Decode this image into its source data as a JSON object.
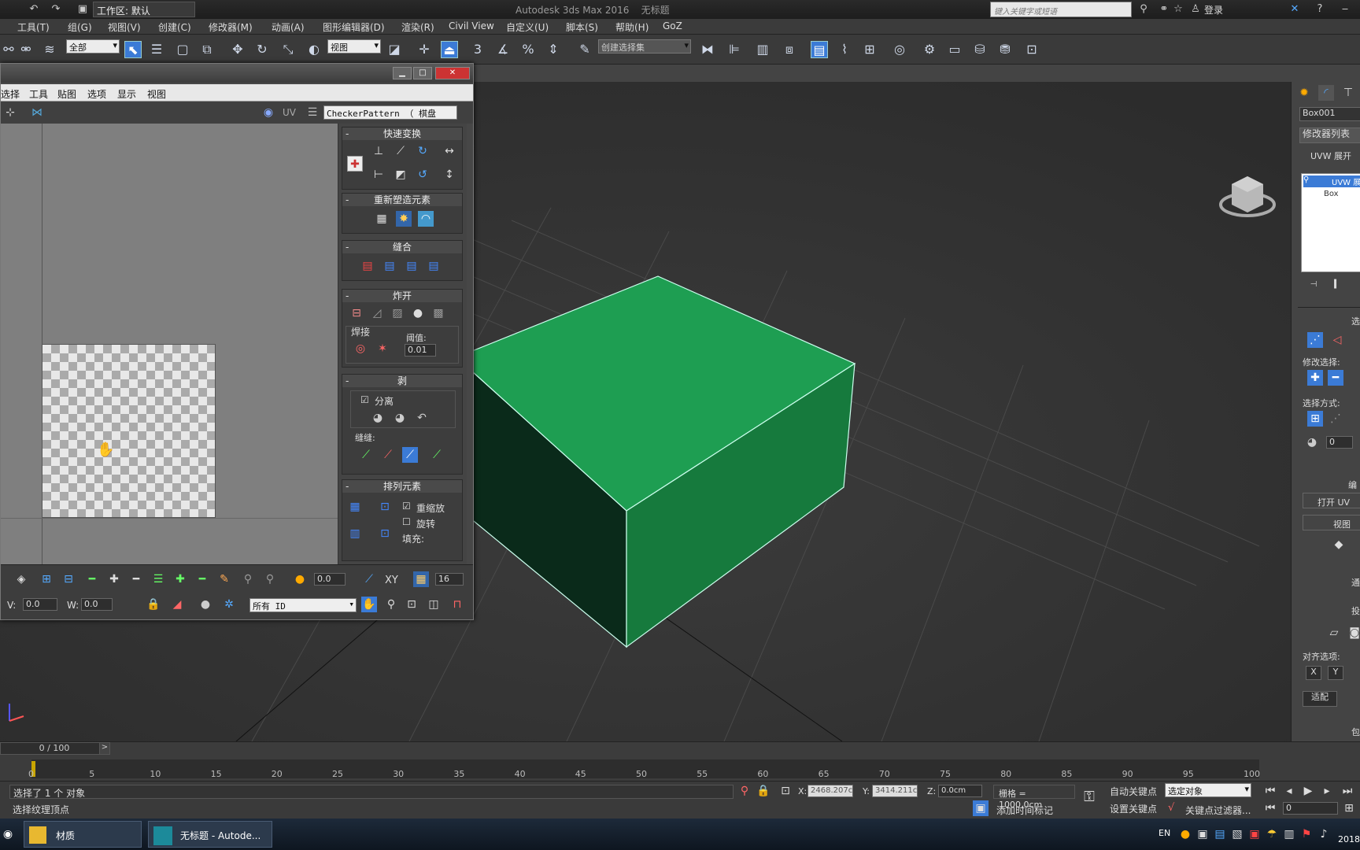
{
  "titlebar": {
    "workspace": "工作区: 默认",
    "app_title": "Autodesk 3ds Max 2016",
    "doc_title": "无标题",
    "search_placeholder": "键入关键字或短语",
    "login": "登录"
  },
  "menu": [
    "工具(T)",
    "组(G)",
    "视图(V)",
    "创建(C)",
    "修改器(M)",
    "动画(A)",
    "图形编辑器(D)",
    "渲染(R)",
    "Civil View",
    "自定义(U)",
    "脚本(S)",
    "帮助(H)",
    "GoZ"
  ],
  "toolbar": {
    "filter": "全部",
    "ref_coord": "视图",
    "named_selection": "创建选择集",
    "num3": "3"
  },
  "uvw": {
    "menu": [
      "选择",
      "工具",
      "贴图",
      "选项",
      "显示",
      "视图"
    ],
    "uv_label": "UV",
    "texture": "CheckerPattern （ 棋盘",
    "rollouts": {
      "quick": "快速变换",
      "reshape": "重新塑造元素",
      "stitch": "缝合",
      "explode": "炸开",
      "weld": "焊接",
      "threshold_label": "阈值:",
      "threshold": "0.01",
      "peel": "剥",
      "detach": "分离",
      "seams": "缝缝:",
      "arrange": "排列元素",
      "rescale": "重缩放",
      "rotate": "旋转",
      "padding": "填充:"
    },
    "bottom": {
      "value1": "0.0",
      "xy": "XY",
      "count": "16",
      "v_label": "V:",
      "v_value": "0.0",
      "w_label": "W:",
      "w_value": "0.0",
      "id_filter": "所有 ID"
    }
  },
  "command_panel": {
    "object_name": "Box001",
    "modifier_list": "修改器列表",
    "uvw_unwrap": "UVW 展开",
    "stack_modifier": "UVW 展",
    "stack_base": "Box",
    "select_label": "选",
    "modify_select": "修改选择:",
    "select_by": "选择方式:",
    "spin_value": "0",
    "edit_label": "编",
    "open_uv": "打开 UV",
    "view_label": "视图",
    "misc1": "通",
    "misc2": "投",
    "align_options": "对齐选项:",
    "align_x": "X",
    "align_y": "Y",
    "fit": "适配",
    "misc3": "包"
  },
  "timeline": {
    "frame": "0 / 100",
    "ticks": [
      "0",
      "5",
      "10",
      "15",
      "20",
      "25",
      "30",
      "35",
      "40",
      "45",
      "50",
      "55",
      "60",
      "65",
      "70",
      "75",
      "80",
      "85",
      "90",
      "95",
      "100"
    ]
  },
  "status": {
    "selected": "选择了 1 个 对象",
    "prompt": "选择纹理顶点",
    "x_label": "X:",
    "x_value": "2468.207c",
    "y_label": "Y:",
    "y_value": "3414.211c",
    "z_label": "Z:",
    "z_value": "0.0cm",
    "grid": "栅格 = 1000.0cm",
    "auto_key": "自动关键点",
    "selected_obj": "选定对象",
    "set_key": "设置关键点",
    "key_filter": "关键点过滤器...",
    "add_time_tag": "添加时间标记",
    "frame_field": "0"
  },
  "taskbar": {
    "items": [
      "材质",
      "无标题 - Autode..."
    ],
    "lang": "EN",
    "clock": "2018"
  },
  "colors": {
    "box_top": "#1e9e52",
    "box_front": "#0a2a1a",
    "box_right": "#167a3d",
    "accent": "#3b7bd6"
  }
}
